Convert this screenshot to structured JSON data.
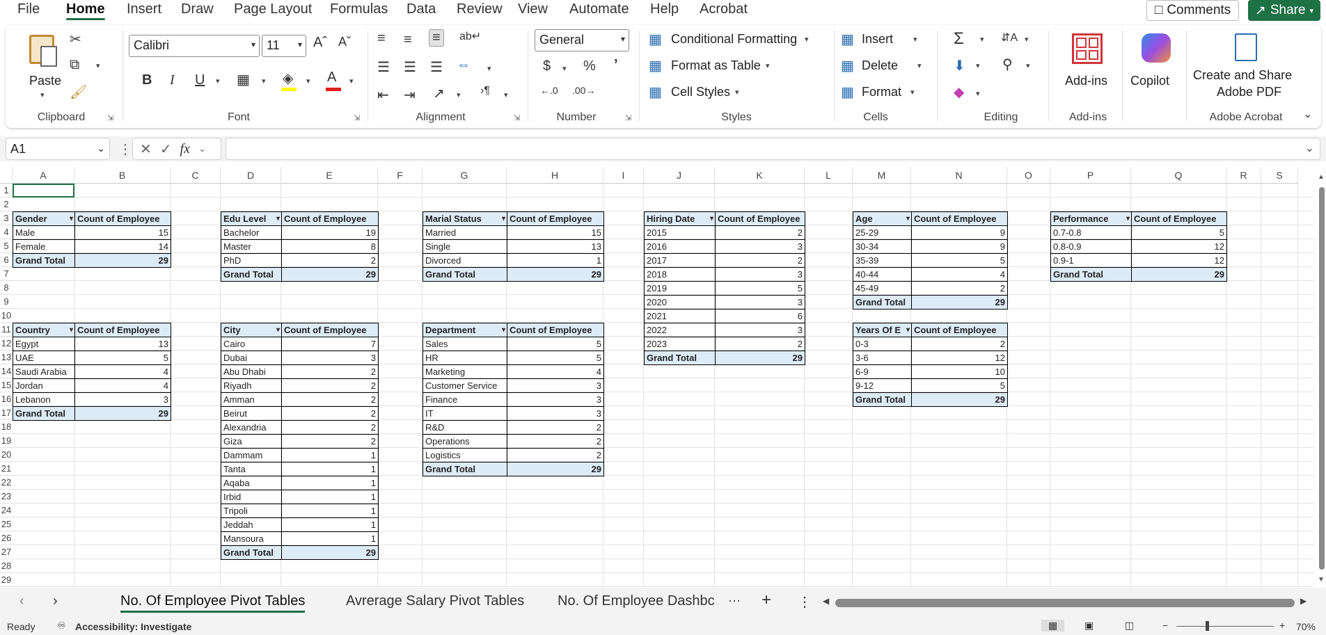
{
  "menu": {
    "tabs": [
      "File",
      "Home",
      "Insert",
      "Draw",
      "Page Layout",
      "Formulas",
      "Data",
      "Review",
      "View",
      "Automate",
      "Help",
      "Acrobat"
    ],
    "comments": "Comments",
    "share": "Share"
  },
  "ribbon": {
    "clipboard": {
      "label": "Clipboard",
      "paste": "Paste"
    },
    "font": {
      "label": "Font",
      "name": "Calibri",
      "size": "11"
    },
    "alignment": {
      "label": "Alignment"
    },
    "number": {
      "label": "Number",
      "format": "General"
    },
    "styles": {
      "label": "Styles",
      "conditional": "Conditional Formatting",
      "format_table": "Format as Table",
      "cell_styles": "Cell Styles"
    },
    "cells": {
      "label": "Cells",
      "insert": "Insert",
      "delete": "Delete",
      "format": "Format"
    },
    "editing": {
      "label": "Editing"
    },
    "addins": {
      "label": "Add-ins",
      "button": "Add-ins"
    },
    "copilot": {
      "button": "Copilot"
    },
    "acrobat": {
      "label": "Adobe Acrobat",
      "button_line1": "Create and Share",
      "button_line2": "Adobe PDF"
    }
  },
  "formula_bar": {
    "name_box": "A1",
    "formula": ""
  },
  "columns": [
    "A",
    "B",
    "C",
    "D",
    "E",
    "F",
    "G",
    "H",
    "I",
    "J",
    "K",
    "L",
    "M",
    "N",
    "O",
    "P",
    "Q",
    "R",
    "S"
  ],
  "rows": [
    "1",
    "2",
    "3",
    "4",
    "5",
    "6",
    "7",
    "8",
    "9",
    "10",
    "11",
    "12",
    "13",
    "14",
    "15",
    "16",
    "17",
    "18",
    "19",
    "20",
    "21",
    "22",
    "23",
    "24",
    "25",
    "26",
    "27",
    "28",
    "29"
  ],
  "pivots": {
    "gender": {
      "headers": [
        "Gender",
        "Count of Employee"
      ],
      "rows": [
        [
          "Male",
          "15"
        ],
        [
          "Female",
          "14"
        ]
      ],
      "total": [
        "Grand Total",
        "29"
      ]
    },
    "edu": {
      "headers": [
        "Edu Level",
        "Count of Employee"
      ],
      "rows": [
        [
          "Bachelor",
          "19"
        ],
        [
          "Master",
          "8"
        ],
        [
          "PhD",
          "2"
        ]
      ],
      "total": [
        "Grand Total",
        "29"
      ]
    },
    "marital": {
      "headers": [
        "Marial Status",
        "Count of Employee"
      ],
      "rows": [
        [
          "Married",
          "15"
        ],
        [
          "Single",
          "13"
        ],
        [
          "Divorced",
          "1"
        ]
      ],
      "total": [
        "Grand Total",
        "29"
      ]
    },
    "hiring": {
      "headers": [
        "Hiring Date",
        "Count of Employee"
      ],
      "rows": [
        [
          "2015",
          "2"
        ],
        [
          "2016",
          "3"
        ],
        [
          "2017",
          "2"
        ],
        [
          "2018",
          "3"
        ],
        [
          "2019",
          "5"
        ],
        [
          "2020",
          "3"
        ],
        [
          "2021",
          "6"
        ],
        [
          "2022",
          "3"
        ],
        [
          "2023",
          "2"
        ]
      ],
      "total": [
        "Grand Total",
        "29"
      ]
    },
    "age": {
      "headers": [
        "Age",
        "Count of Employee"
      ],
      "rows": [
        [
          "25-29",
          "9"
        ],
        [
          "30-34",
          "9"
        ],
        [
          "35-39",
          "5"
        ],
        [
          "40-44",
          "4"
        ],
        [
          "45-49",
          "2"
        ]
      ],
      "total": [
        "Grand Total",
        "29"
      ]
    },
    "performance": {
      "headers": [
        "Performance",
        "Count of Employee"
      ],
      "rows": [
        [
          "0.7-0.8",
          "5"
        ],
        [
          "0.8-0.9",
          "12"
        ],
        [
          "0.9-1",
          "12"
        ]
      ],
      "total": [
        "Grand Total",
        "29"
      ]
    },
    "country": {
      "headers": [
        "Country",
        "Count of Employee"
      ],
      "rows": [
        [
          "Egypt",
          "13"
        ],
        [
          "UAE",
          "5"
        ],
        [
          "Saudi Arabia",
          "4"
        ],
        [
          "Jordan",
          "4"
        ],
        [
          "Lebanon",
          "3"
        ]
      ],
      "total": [
        "Grand Total",
        "29"
      ]
    },
    "city": {
      "headers": [
        "City",
        "Count of Employee"
      ],
      "rows": [
        [
          "Cairo",
          "7"
        ],
        [
          "Dubai",
          "3"
        ],
        [
          "Abu Dhabi",
          "2"
        ],
        [
          "Riyadh",
          "2"
        ],
        [
          "Amman",
          "2"
        ],
        [
          "Beirut",
          "2"
        ],
        [
          "Alexandria",
          "2"
        ],
        [
          "Giza",
          "2"
        ],
        [
          "Dammam",
          "1"
        ],
        [
          "Tanta",
          "1"
        ],
        [
          "Aqaba",
          "1"
        ],
        [
          "Irbid",
          "1"
        ],
        [
          "Tripoli",
          "1"
        ],
        [
          "Jeddah",
          "1"
        ],
        [
          "Mansoura",
          "1"
        ]
      ],
      "total": [
        "Grand Total",
        "29"
      ]
    },
    "department": {
      "headers": [
        "Department",
        "Count of Employee"
      ],
      "rows": [
        [
          "Sales",
          "5"
        ],
        [
          "HR",
          "5"
        ],
        [
          "Marketing",
          "4"
        ],
        [
          "Customer Service",
          "3"
        ],
        [
          "Finance",
          "3"
        ],
        [
          "IT",
          "3"
        ],
        [
          "R&D",
          "2"
        ],
        [
          "Operations",
          "2"
        ],
        [
          "Logistics",
          "2"
        ]
      ],
      "total": [
        "Grand Total",
        "29"
      ]
    },
    "years": {
      "headers": [
        "Years Of E",
        "Count of Employee"
      ],
      "rows": [
        [
          "0-3",
          "2"
        ],
        [
          "3-6",
          "12"
        ],
        [
          "6-9",
          "10"
        ],
        [
          "9-12",
          "5"
        ]
      ],
      "total": [
        "Grand Total",
        "29"
      ]
    }
  },
  "sheets": [
    "No. Of Employee Pivot Tables",
    "Avrerage Salary Pivot Tables",
    "No. Of Employee Dashbc"
  ],
  "status": {
    "ready": "Ready",
    "accessibility": "Accessibility: Investigate",
    "zoom": "70%"
  }
}
